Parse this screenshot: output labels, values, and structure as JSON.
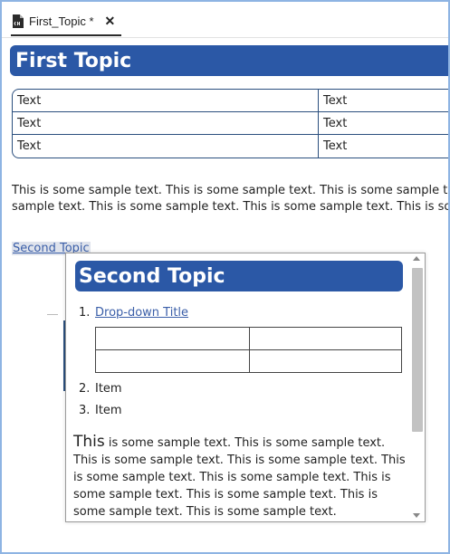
{
  "tab": {
    "label": "First_Topic *",
    "close": "✕",
    "icon": "html-file-icon"
  },
  "topic1": {
    "title": "First Topic",
    "table": [
      [
        "Text",
        "Text"
      ],
      [
        "Text",
        "Text"
      ],
      [
        "Text",
        "Text"
      ]
    ],
    "paragraph_line1": "This is some sample text. This is some sample text. This is some sample text.",
    "paragraph_line2": "sample text. This is some sample text. This is some sample text. This is some sample text.",
    "link_text": "Second Topic"
  },
  "popup": {
    "title": "Second Topic",
    "list": [
      {
        "num": "1.",
        "label": "Drop-down Title"
      },
      {
        "num": "2.",
        "label": "Item"
      },
      {
        "num": "3.",
        "label": "Item"
      }
    ],
    "paragraph_first_word": "This",
    "paragraph_rest": " is some sample text. This is some sample text. This is some sample text. This is some sample text. This is some sample text. This is some sample text. This is some sample text. This is some sample text. This is some sample text. This is some sample text."
  },
  "colors": {
    "heading_bar": "#2b58a6",
    "link": "#3a5ea8",
    "window_border": "#8eb4e3"
  }
}
